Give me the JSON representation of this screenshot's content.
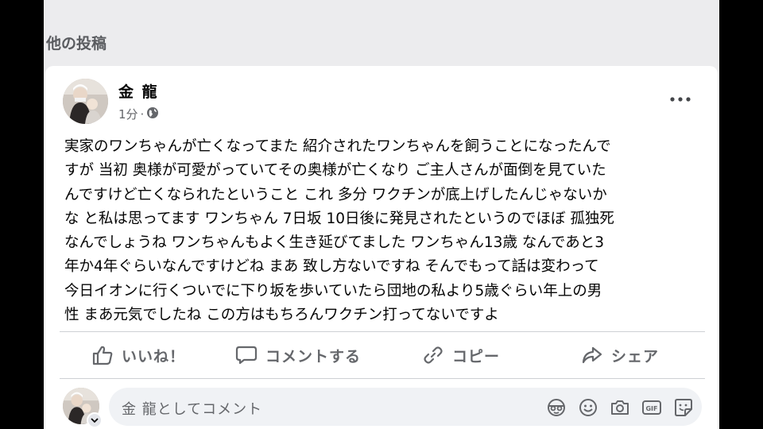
{
  "section_title": "他の投稿",
  "post": {
    "author": "金 龍",
    "time": "1分",
    "separator": "·",
    "lines": [
      "実家のワンちゃんが亡くなってまた 紹介されたワンちゃんを飼うことになったんで",
      "すが 当初 奥様が可愛がっていてその奥様が亡くなり ご主人さんが面倒を見ていた",
      "んですけど亡くなられたということ これ 多分 ワクチンが底上げしたんじゃないか",
      "な と私は思ってます ワンちゃん 7日坂 10日後に発見されたというのでほぼ 孤独死",
      "なんでしょうね ワンちゃんもよく生き延びてました ワンちゃん13歳 なんであと3",
      "年か4年ぐらいなんですけどね まあ 致し方ないですね そんでもって話は変わって",
      "今日イオンに行くついでに下り坂を歩いていたら団地の私より5歳ぐらい年上の男",
      "性 まあ元気でしたね この方はもちろんワクチン打ってないですよ"
    ]
  },
  "actions": {
    "like": "いいね！",
    "comment": "コメントする",
    "copy": "コピー",
    "share": "シェア"
  },
  "comment_box": {
    "placeholder": "金 龍としてコメント"
  },
  "icons": {
    "privacy": "globe-icon",
    "more": "ellipsis-icon",
    "like": "thumbs-up-icon",
    "comment": "speech-bubble-icon",
    "copy": "link-icon",
    "share": "share-arrow-icon",
    "comment_tools": [
      "avatar-sticker-icon",
      "emoji-icon",
      "camera-icon",
      "gif-icon",
      "sticker-icon"
    ]
  }
}
